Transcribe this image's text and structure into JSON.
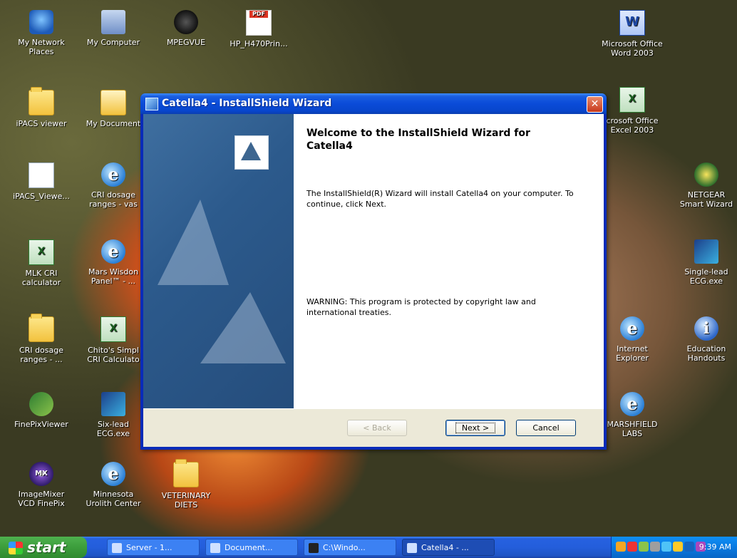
{
  "desktop": {
    "icons": [
      {
        "label": "My Network Places",
        "icon": "network-places-icon"
      },
      {
        "label": "My Computer",
        "icon": "computer-icon"
      },
      {
        "label": "MPEGVUE",
        "icon": "mpegvue-icon"
      },
      {
        "label": "HP_H470Prin...",
        "icon": "pdf-icon"
      },
      {
        "label": "Microsoft Office Word 2003",
        "icon": "word-icon"
      },
      {
        "label": "iPACS viewer",
        "icon": "folder-icon"
      },
      {
        "label": "My Document",
        "icon": "documents-icon"
      },
      {
        "label": "crosoft Office Excel 2003",
        "icon": "excel-icon"
      },
      {
        "label": "iPACS_Viewe...",
        "icon": "pacs-icon"
      },
      {
        "label": "CRI dosage ranges - vas",
        "icon": "ie-icon"
      },
      {
        "label": "NETGEAR Smart Wizard",
        "icon": "netgear-icon"
      },
      {
        "label": "MLK CRI calculator",
        "icon": "excel-icon"
      },
      {
        "label": "Mars Wisdon Panel™ - ...",
        "icon": "ie-icon"
      },
      {
        "label": "Single-lead ECG.exe",
        "icon": "ecg-icon"
      },
      {
        "label": "CRI dosage ranges - ...",
        "icon": "folder-icon"
      },
      {
        "label": "Chito's Simpl CRI Calculato",
        "icon": "excel-icon"
      },
      {
        "label": "Internet Explorer",
        "icon": "ie-icon"
      },
      {
        "label": "Education Handouts",
        "icon": "info-icon"
      },
      {
        "label": "FinePixViewer",
        "icon": "finepix-icon"
      },
      {
        "label": "Six-lead ECG.exe",
        "icon": "ecg-icon"
      },
      {
        "label": "MARSHFIELD LABS",
        "icon": "ie-icon"
      },
      {
        "label": "ImageMixer VCD FinePix",
        "icon": "imagemixer-icon"
      },
      {
        "label": "Minnesota Urolith Center",
        "icon": "ie-icon"
      },
      {
        "label": "VETERINARY DIETS",
        "icon": "folder-icon"
      }
    ]
  },
  "wizard": {
    "title": "Catella4 - InstallShield Wizard",
    "heading": "Welcome to the InstallShield Wizard for Catella4",
    "body": "The InstallShield(R) Wizard will install Catella4 on your computer. To continue, click Next.",
    "warning": "WARNING: This program is protected by copyright law and international treaties.",
    "buttons": {
      "back": "< Back",
      "next": "Next >",
      "cancel": "Cancel"
    },
    "close_glyph": "✕"
  },
  "taskbar": {
    "start_label": "start",
    "tasks": [
      {
        "label": "Server - 1..."
      },
      {
        "label": "Document..."
      },
      {
        "label": "C:\\Windo..."
      },
      {
        "label": "Catella4 - ..."
      }
    ],
    "clock": "9:39 AM"
  },
  "colors": {
    "titlebar": "#0a4bd8",
    "taskbar": "#245edb",
    "start": "#3c9d3c",
    "close": "#c8391c"
  }
}
